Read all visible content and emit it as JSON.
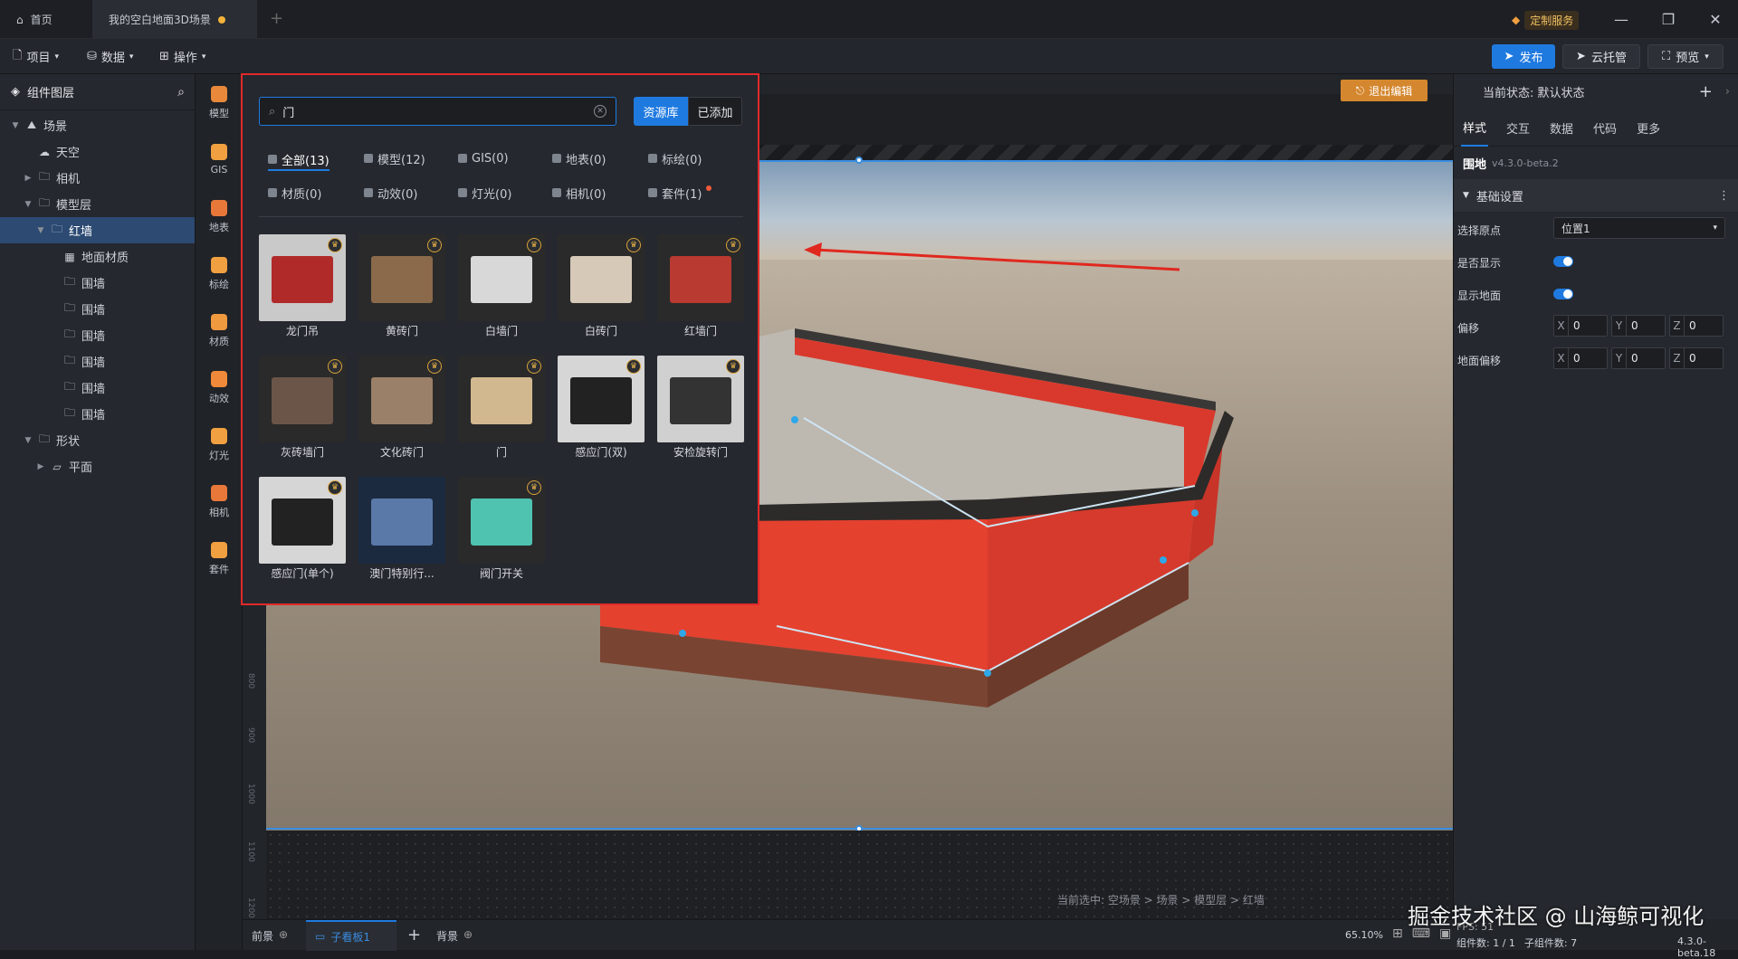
{
  "titlebar": {
    "home_tab": "首页",
    "scene_tab": "我的空白地面3D场景",
    "custom_service": "定制服务"
  },
  "toolbar": {
    "menu_project": "项目",
    "menu_data": "数据",
    "menu_ops": "操作",
    "publish": "发布",
    "cloud": "云托管",
    "preview": "预览"
  },
  "layers": {
    "title": "组件图层",
    "items": [
      {
        "label": "场景",
        "level": 0,
        "caret": "▼",
        "icon": "scene-icon"
      },
      {
        "label": "天空",
        "level": 1,
        "caret": "",
        "icon": "sky-icon"
      },
      {
        "label": "相机",
        "level": 1,
        "caret": "▶",
        "icon": "folder-icon"
      },
      {
        "label": "模型层",
        "level": 1,
        "caret": "▼",
        "icon": "folder-icon"
      },
      {
        "label": "红墙",
        "level": 2,
        "caret": "▼",
        "icon": "folder-icon",
        "selected": true
      },
      {
        "label": "地面材质",
        "level": 3,
        "caret": "",
        "icon": "material-icon"
      },
      {
        "label": "围墙",
        "level": 3,
        "caret": "",
        "icon": "folder-icon"
      },
      {
        "label": "围墙",
        "level": 3,
        "caret": "",
        "icon": "folder-icon"
      },
      {
        "label": "围墙",
        "level": 3,
        "caret": "",
        "icon": "folder-icon"
      },
      {
        "label": "围墙",
        "level": 3,
        "caret": "",
        "icon": "folder-icon"
      },
      {
        "label": "围墙",
        "level": 3,
        "caret": "",
        "icon": "folder-icon"
      },
      {
        "label": "围墙",
        "level": 3,
        "caret": "",
        "icon": "folder-icon"
      },
      {
        "label": "形状",
        "level": 1,
        "caret": "▼",
        "icon": "folder-icon"
      },
      {
        "label": "平面",
        "level": 2,
        "caret": "▶",
        "icon": "plane-icon"
      }
    ]
  },
  "sidebar": {
    "items": [
      {
        "label": "模型",
        "color": "#e8883a"
      },
      {
        "label": "GIS",
        "color": "#f0a040"
      },
      {
        "label": "地表",
        "color": "#e8783a"
      },
      {
        "label": "标绘",
        "color": "#f0a040"
      },
      {
        "label": "材质",
        "color": "#f09a40"
      },
      {
        "label": "动效",
        "color": "#f08a3a"
      },
      {
        "label": "灯光",
        "color": "#f0a040"
      },
      {
        "label": "相机",
        "color": "#e8783a"
      },
      {
        "label": "套件",
        "color": "#f0a040"
      }
    ]
  },
  "popup": {
    "search_value": "门",
    "seg_library": "资源库",
    "seg_added": "已添加",
    "categories": [
      "全部(13)",
      "模型(12)",
      "GIS(0)",
      "地表(0)",
      "标绘(0)",
      "材质(0)",
      "动效(0)",
      "灯光(0)",
      "相机(0)",
      "套件(1)"
    ],
    "assets": [
      {
        "label": "龙门吊",
        "bg": "#c9c9c9",
        "fg": "#b02a2a"
      },
      {
        "label": "黄砖门",
        "bg": "#2a2a2a",
        "fg": "#8a6a4a"
      },
      {
        "label": "白墙门",
        "bg": "#2a2a2a",
        "fg": "#d8d8d8"
      },
      {
        "label": "白砖门",
        "bg": "#2a2a2a",
        "fg": "#d6c9b8"
      },
      {
        "label": "红墙门",
        "bg": "#2a2a2a",
        "fg": "#b83a30"
      },
      {
        "label": "灰砖墙门",
        "bg": "#2a2a2a",
        "fg": "#6a5548"
      },
      {
        "label": "文化砖门",
        "bg": "#2a2a2a",
        "fg": "#9a8068"
      },
      {
        "label": "门",
        "bg": "#2a2a2a",
        "fg": "#d2b88e"
      },
      {
        "label": "感应门(双)",
        "bg": "#d6d6d6",
        "fg": "#222222"
      },
      {
        "label": "安检旋转门",
        "bg": "#d0d0d0",
        "fg": "#333333"
      },
      {
        "label": "感应门(单个)",
        "bg": "#d6d6d6",
        "fg": "#222222"
      },
      {
        "label": "澳门特别行...",
        "bg": "#1b2a3f",
        "fg": "#5a79a8"
      },
      {
        "label": "阀门开关",
        "bg": "#2a2a2a",
        "fg": "#4fc3b0"
      }
    ]
  },
  "viewport": {
    "exit_edit": "退出编辑",
    "ruler_marks": [
      "800",
      "900",
      "1000",
      "1100",
      "1200"
    ],
    "breadcrumb": "当前选中: 空场景 > 场景 > 模型层 > 红墙"
  },
  "bottom": {
    "foreground": "前景",
    "subpanel": "子看板1",
    "background": "背景",
    "zoom": "65.10%"
  },
  "right": {
    "state_label": "当前状态: 默认状态",
    "tabs": [
      "样式",
      "交互",
      "数据",
      "代码",
      "更多"
    ],
    "component": "围地",
    "version": "v4.3.0-beta.2",
    "section": "基础设置",
    "origin_label": "选择原点",
    "origin_value": "位置1",
    "show_label": "是否显示",
    "ground_label": "显示地面",
    "offset_label": "偏移",
    "ground_offset_label": "地面偏移",
    "x": "0",
    "y": "0",
    "z": "0"
  },
  "status": {
    "components": "组件数: 1 / 1",
    "children": "子组件数: 7",
    "fps": "FPS: 51",
    "build": "4.3.0-beta.18"
  },
  "watermark": "掘金技术社区 @ 山海鲸可视化"
}
